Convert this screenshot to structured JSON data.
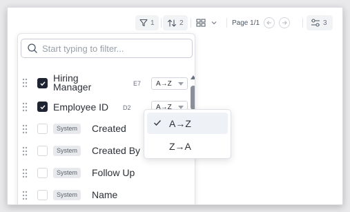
{
  "toolbar": {
    "filter_count": "1",
    "sort_count": "2",
    "page_label": "Page 1/1",
    "columns_count": "3"
  },
  "panel": {
    "search_placeholder": "Start typing to filter...",
    "rows": [
      {
        "label": "Hiring Manager",
        "code": "E7",
        "checked": true,
        "direction": "A→Z"
      },
      {
        "label": "Employee ID",
        "code": "D2",
        "checked": true,
        "direction": "A→Z"
      },
      {
        "label": "Created",
        "badge": "System",
        "checked": false
      },
      {
        "label": "Created By",
        "badge": "System",
        "checked": false
      },
      {
        "label": "Follow Up",
        "badge": "System",
        "checked": false
      },
      {
        "label": "Name",
        "badge": "System",
        "checked": false
      }
    ]
  },
  "sort_menu": {
    "options": [
      "A→Z",
      "Z→A"
    ],
    "selected": "A→Z"
  },
  "icons": {
    "filter": "filter-icon",
    "sort": "sort-icon",
    "grid": "grid-icon",
    "prev": "arrow-left-icon",
    "next": "arrow-right-icon",
    "columns": "sliders-icon",
    "search": "search-icon",
    "drag": "drag-handle-icon",
    "check": "check-icon"
  },
  "colors": {
    "checkbox_checked": "#1f2433",
    "menu_active_bg": "#eef1f6"
  }
}
